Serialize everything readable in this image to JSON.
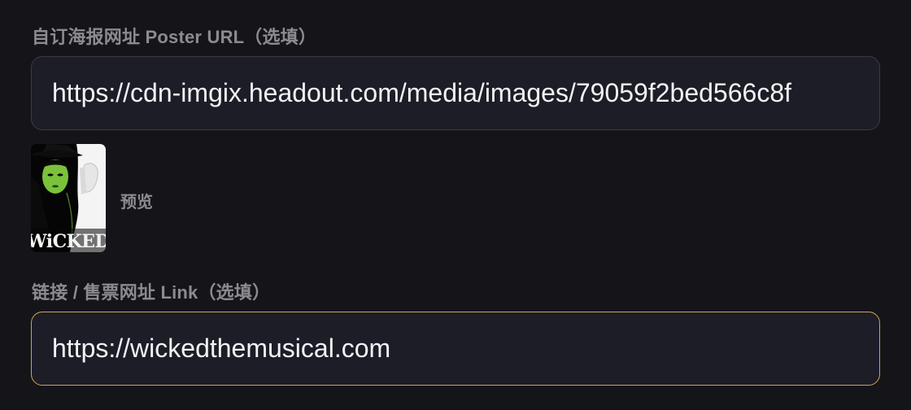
{
  "poster_field": {
    "label": "自订海报网址 Poster URL（选填）",
    "value": "https://cdn-imgix.headout.com/media/images/79059f2bed566c8f",
    "placeholder": ""
  },
  "preview": {
    "caption": "预览",
    "image_text": "WiCKED",
    "image_alt": "Wicked poster"
  },
  "link_field": {
    "label": "链接 / 售票网址 Link（选填）",
    "value": "https://wickedthemusical.com",
    "placeholder": ""
  },
  "colors": {
    "background": "#151519",
    "input_background": "#1d1d27",
    "input_border": "#3b3b47",
    "focused_border": "#c8a657",
    "label": "#8b8b90",
    "text": "#f2f2f5",
    "wicked_green": "#7bc23a"
  }
}
